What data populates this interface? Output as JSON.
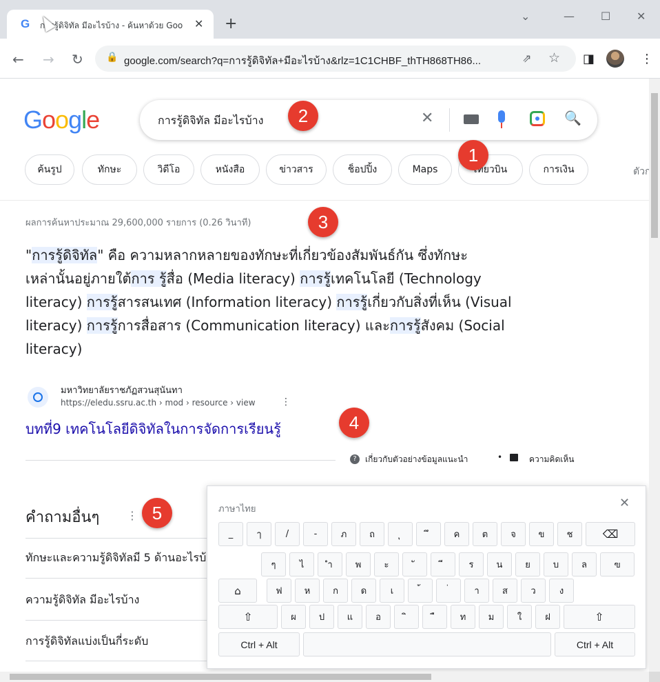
{
  "browser": {
    "tab_title": "การรู้ดิจิทัล มีอะไรบ้าง - ค้นหาด้วย Goo",
    "tab_favicon": "G",
    "url": "google.com/search?q=การรู้ดิจิทัล+มีอะไรบ้าง&rlz=1C1CHBF_thTH868TH86..."
  },
  "search": {
    "query": "การรู้ดิจิทัล มีอะไรบ้าง"
  },
  "logo": [
    "G",
    "o",
    "o",
    "g",
    "l",
    "e"
  ],
  "chips": [
    "ค้นรูป",
    "ทักษะ",
    "วิดีโอ",
    "หนังสือ",
    "ข่าวสาร",
    "ช็อปปิ้ง",
    "Maps",
    "เที่ยวบิน",
    "การเงิน"
  ],
  "chip_more": "ตัวก",
  "results": {
    "stats": "ผลการค้นหาประมาณ 29,600,000 รายการ (0.26 วินาที)",
    "snippet": {
      "line1_a": "\"",
      "line1_hl": "การรู้ดิจิทัล",
      "line1_b": "\" คือ ความหลากหลายของทักษะที่เกี่ยวข้องสัมพันธ์กัน ซึ่งทักษะ",
      "line2_a": "เหล่านั้นอยู่ภายใต้",
      "line2_hl": "การ รู้",
      "line2_b": "สื่อ (Media literacy) ",
      "line2_hl2": "การรู้",
      "line2_c": "เทคโนโลยี (Technology",
      "line3_a": "literacy) ",
      "line3_hl": "การรู้",
      "line3_b": "สารสนเทศ (Information literacy) ",
      "line3_hl2": "การรู้",
      "line3_c": "เกี่ยวกับสิ่งที่เห็น (Visual",
      "line4_a": "literacy) ",
      "line4_hl": "การรู้",
      "line4_b": "การสื่อสาร (Communication literacy) และ",
      "line4_hl2": "การรู้",
      "line4_c": "สังคม (Social",
      "line5": "literacy)"
    },
    "site_name": "มหาวิทยาลัยราชภัฏสวนสุนันทา",
    "site_url": "https://eledu.ssru.ac.th › mod › resource › view",
    "link_title": "บทที่9 เทคโนโลยีดิจิทัลในการจัดการเรียนรู้",
    "about": "เกี่ยวกับตัวอย่างข้อมูลแนะนำ",
    "feedback": "ความคิดเห็น"
  },
  "paa": {
    "title": "คำถามอื่นๆ",
    "items": [
      "ทักษะและความรู้ดิจิทัลมี 5 ด้านอะไรบ้าง",
      "ความรู้ดิจิทัล มีอะไรบ้าง",
      "การรู้ดิจิทัลแบ่งเป็นกี่ระดับ"
    ]
  },
  "badges": [
    "1",
    "2",
    "3",
    "4",
    "5"
  ],
  "keyboard": {
    "title": "ภาษาไทย",
    "row1": [
      "_",
      "ๅ",
      "/",
      "-",
      "ภ",
      "ถ",
      "ุ",
      "ึ",
      "ค",
      "ต",
      "จ",
      "ข",
      "ช"
    ],
    "row2": [
      "ๆ",
      "ไ",
      "ำ",
      "พ",
      "ะ",
      "ั",
      "ี",
      "ร",
      "น",
      "ย",
      "บ",
      "ล",
      "ฃ"
    ],
    "row3": [
      "ฟ",
      "ห",
      "ก",
      "ด",
      "เ",
      "้",
      "่",
      "า",
      "ส",
      "ว",
      "ง"
    ],
    "row4": [
      "ผ",
      "ป",
      "แ",
      "อ",
      "ิ",
      "ื",
      "ท",
      "ม",
      "ใ",
      "ฝ"
    ],
    "ctrl_alt": "Ctrl + Alt"
  }
}
